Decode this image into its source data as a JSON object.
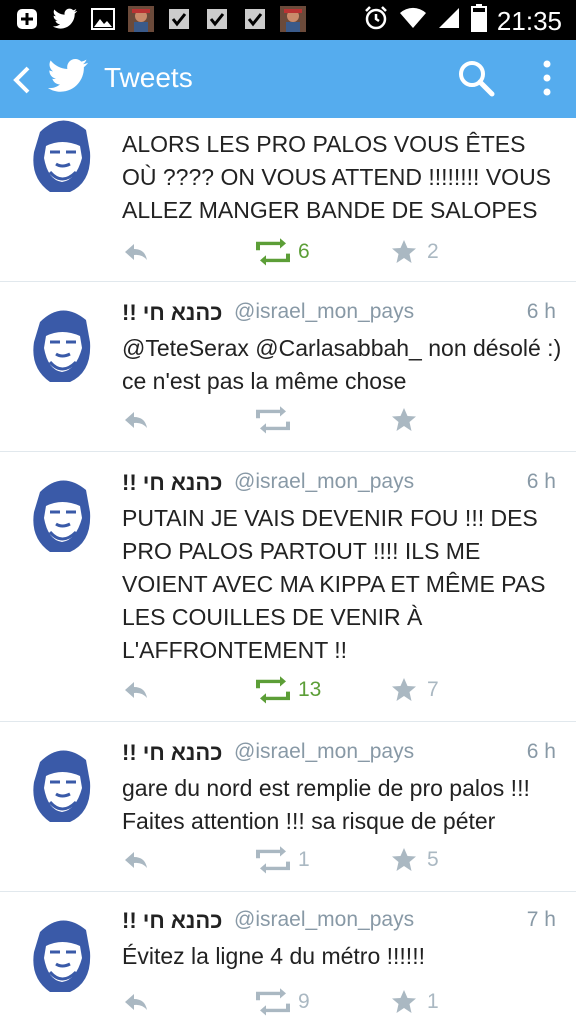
{
  "status_bar": {
    "time": "21:35",
    "left_icons": [
      "plus-box-icon",
      "twitter-bird-icon",
      "image-icon",
      "avatar-notification-icon",
      "checkbox-icon",
      "checkbox-icon",
      "checkbox-icon",
      "avatar-notification-icon"
    ],
    "right_icons": [
      "alarm-icon",
      "wifi-icon",
      "signal-icon",
      "battery-icon"
    ]
  },
  "app_bar": {
    "title": "Tweets",
    "color": "#55acee"
  },
  "tweets": [
    {
      "name": "",
      "handle": "",
      "time": "",
      "text": "ALORS LES PRO PALOS VOUS ÊTES OÙ ???? ON VOUS ATTEND !!!!!!!! VOUS ALLEZ MANGER BANDE DE SALOPES",
      "retweets": "6",
      "retweeted": true,
      "favorites": "2"
    },
    {
      "name": "!! כהנא חי",
      "handle": "@israel_mon_pays",
      "time": "6 h",
      "text": "@TeteSerax @Carlasabbah_ non désolé :) ce n'est pas la même chose",
      "retweets": "",
      "retweeted": false,
      "favorites": ""
    },
    {
      "name": "!! כהנא חי",
      "handle": "@israel_mon_pays",
      "time": "6 h",
      "text": "PUTAIN JE VAIS DEVENIR FOU !!! DES PRO PALOS PARTOUT !!!! ILS ME VOIENT AVEC MA KIPPA ET MÊME PAS LES COUILLES DE VENIR À L'AFFRONTEMENT !!",
      "retweets": "13",
      "retweeted": true,
      "favorites": "7"
    },
    {
      "name": "!! כהנא חי",
      "handle": "@israel_mon_pays",
      "time": "6 h",
      "text": "gare du nord est remplie de pro palos !!! Faites attention !!! sa risque de péter",
      "retweets": "1",
      "retweeted": false,
      "favorites": "5"
    },
    {
      "name": "!! כהנא חי",
      "handle": "@israel_mon_pays",
      "time": "7 h",
      "text": "Évitez la ligne 4 du métro !!!!!!",
      "retweets": "9",
      "retweeted": false,
      "favorites": "1"
    }
  ]
}
